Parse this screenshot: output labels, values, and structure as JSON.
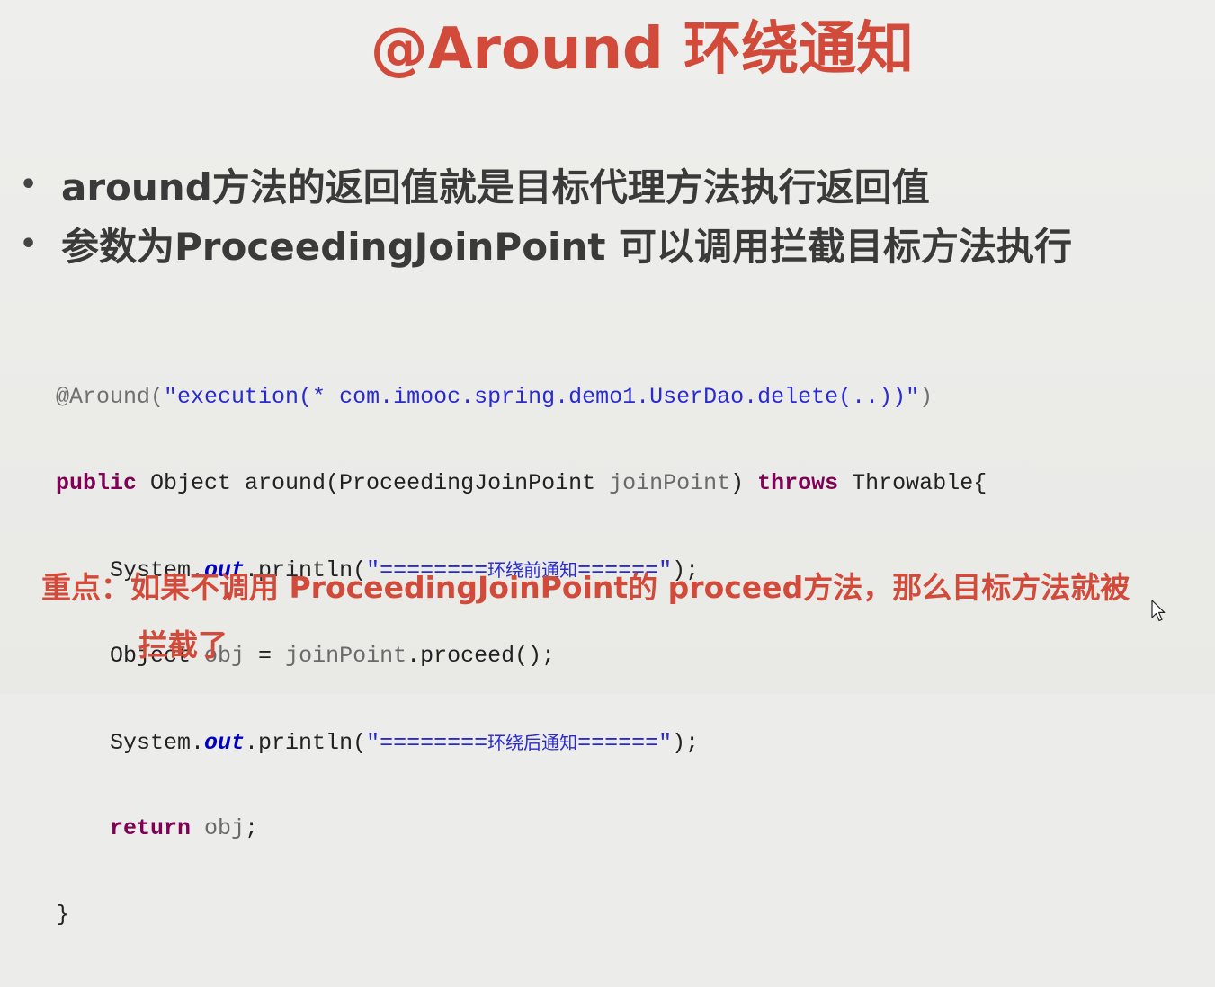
{
  "slide": {
    "title": "@Around 环绕通知",
    "bullets": [
      "around方法的返回值就是目标代理方法执行返回值",
      "参数为ProceedingJoinPoint 可以调用拦截目标方法执行"
    ],
    "bullet_marker": "•",
    "code": {
      "l1_annotation": "@Around(",
      "l1_string": "\"execution(* com.imooc.spring.demo1.UserDao.delete(..))\"",
      "l1_close": ")",
      "l2_kw_public": "public",
      "l2_mid": " Object around(ProceedingJoinPoint ",
      "l2_param": "joinPoint",
      "l2_paren": ") ",
      "l2_kw_throws": "throws",
      "l2_end": " Throwable{",
      "l3_a": "    System.",
      "l3_out": "out",
      "l3_b": ".println(",
      "l3_str_a": "\"========",
      "l3_str_cn": "环绕前通知",
      "l3_str_b": "======\"",
      "l3_c": ");",
      "l4_a": "    Object ",
      "l4_obj": "obj",
      "l4_b": " = ",
      "l4_jp": "joinPoint",
      "l4_c": ".proceed();",
      "l5_a": "    System.",
      "l5_out": "out",
      "l5_b": ".println(",
      "l5_str_a": "\"========",
      "l5_str_cn": "环绕后通知",
      "l5_str_b": "======\"",
      "l5_c": ");",
      "l6_indent": "    ",
      "l6_return": "return",
      "l6_sp": " ",
      "l6_obj": "obj",
      "l6_semi": ";",
      "l7": "}"
    },
    "note": {
      "line1": "重点：如果不调用 ProceedingJoinPoint的 proceed方法，那么目标方法就被",
      "line2": "拦截了"
    },
    "colors": {
      "title_red": "#d14a3a",
      "keyword": "#7f0055",
      "string": "#2a2ad0",
      "field": "#0000c0"
    }
  }
}
